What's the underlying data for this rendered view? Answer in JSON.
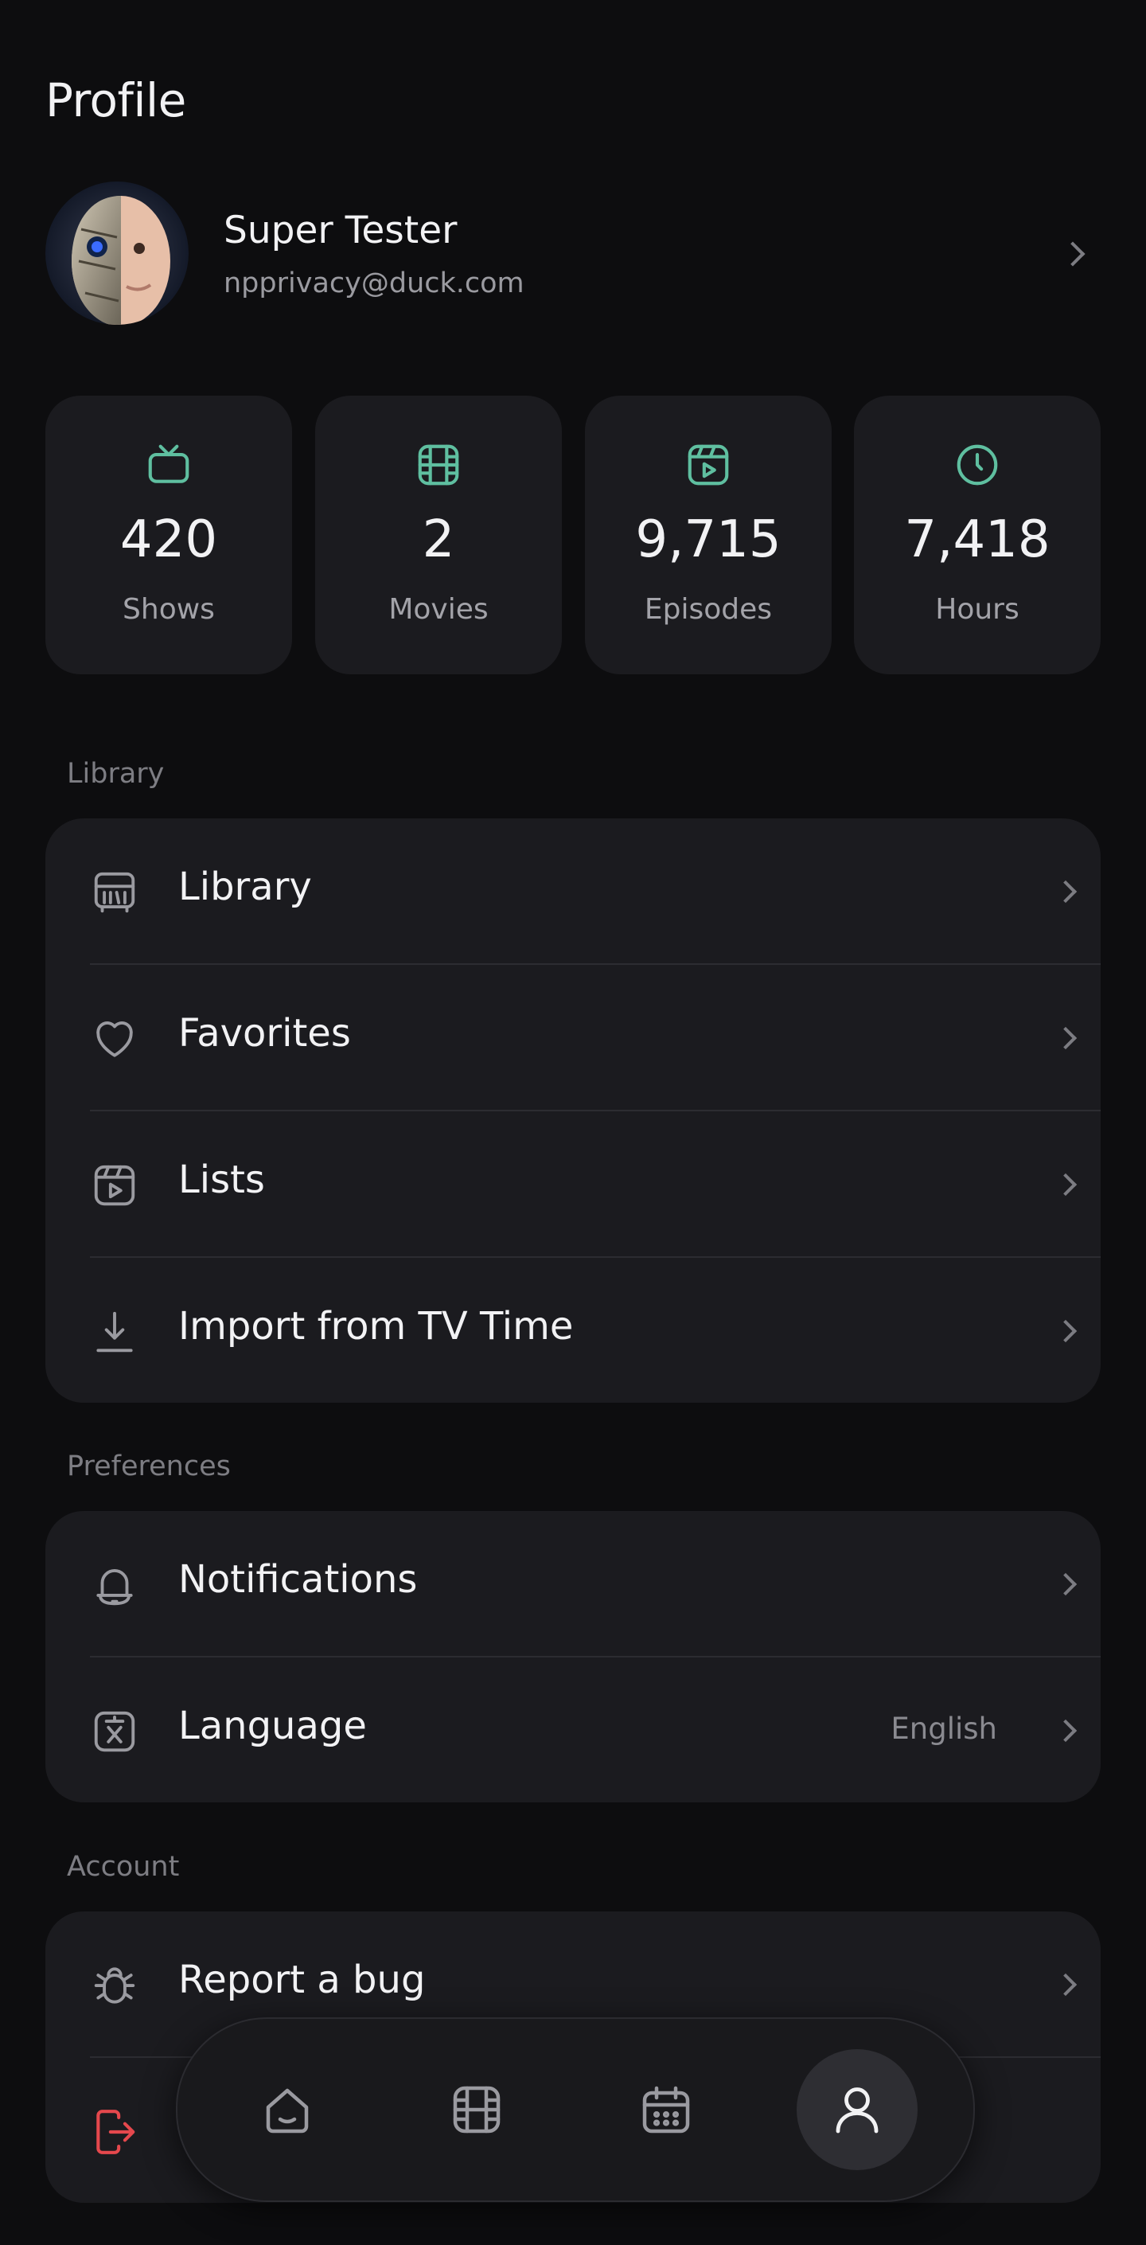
{
  "header": {
    "title": "Profile"
  },
  "profile": {
    "name": "Super Tester",
    "email": "npprivacy@duck.com"
  },
  "stats": [
    {
      "icon": "tv-icon",
      "value": "420",
      "label": "Shows"
    },
    {
      "icon": "film-icon",
      "value": "2",
      "label": "Movies"
    },
    {
      "icon": "clapper-icon",
      "value": "9,715",
      "label": "Episodes"
    },
    {
      "icon": "clock-icon",
      "value": "7,418",
      "label": "Hours"
    }
  ],
  "sections": {
    "library": {
      "label": "Library",
      "items": [
        {
          "icon": "library-icon",
          "label": "Library"
        },
        {
          "icon": "heart-icon",
          "label": "Favorites"
        },
        {
          "icon": "clapper-icon",
          "label": "Lists"
        },
        {
          "icon": "download-icon",
          "label": "Import from TV Time"
        }
      ]
    },
    "preferences": {
      "label": "Preferences",
      "items": [
        {
          "icon": "bell-icon",
          "label": "Notifications"
        },
        {
          "icon": "translate-icon",
          "label": "Language",
          "value": "English"
        }
      ]
    },
    "account": {
      "label": "Account",
      "items": [
        {
          "icon": "bug-icon",
          "label": "Report a bug"
        },
        {
          "icon": "logout-icon",
          "label": ""
        }
      ]
    }
  },
  "tabbar": {
    "tabs": [
      {
        "icon": "home-icon",
        "active": false
      },
      {
        "icon": "film-icon",
        "active": false
      },
      {
        "icon": "calendar-icon",
        "active": false
      },
      {
        "icon": "user-icon",
        "active": true
      }
    ]
  },
  "colors": {
    "accent": "#5fbfa0",
    "danger": "#e5484d",
    "background": "#0d0d0f",
    "card": "#1b1b1f"
  }
}
